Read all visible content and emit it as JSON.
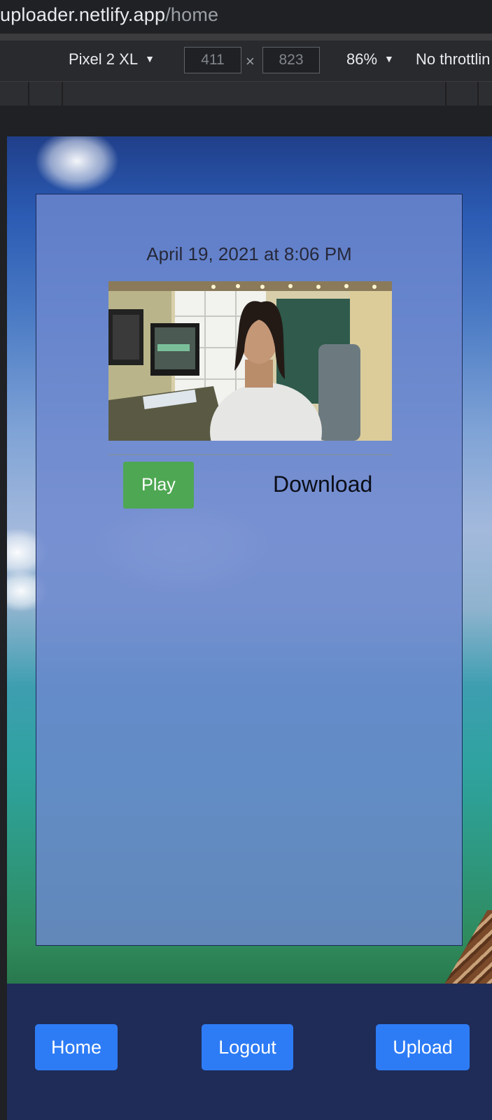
{
  "browser": {
    "url_host": "uploader.netlify.app",
    "url_path": "/home"
  },
  "devtools": {
    "device": "Pixel 2 XL",
    "width": "411",
    "height": "823",
    "times": "×",
    "zoom": "86%",
    "throttling": "No throttlin",
    "caret": "▼"
  },
  "card": {
    "date": "April 19, 2021 at 8:06 PM",
    "play_label": "Play",
    "download_label": "Download"
  },
  "nav": {
    "home_label": "Home",
    "logout_label": "Logout",
    "upload_label": "Upload"
  },
  "colors": {
    "play_button": "#4ea752",
    "nav_button": "#2d7cf6",
    "navbar_bg": "#1f2c58",
    "card_bg": "#6e88ce"
  }
}
